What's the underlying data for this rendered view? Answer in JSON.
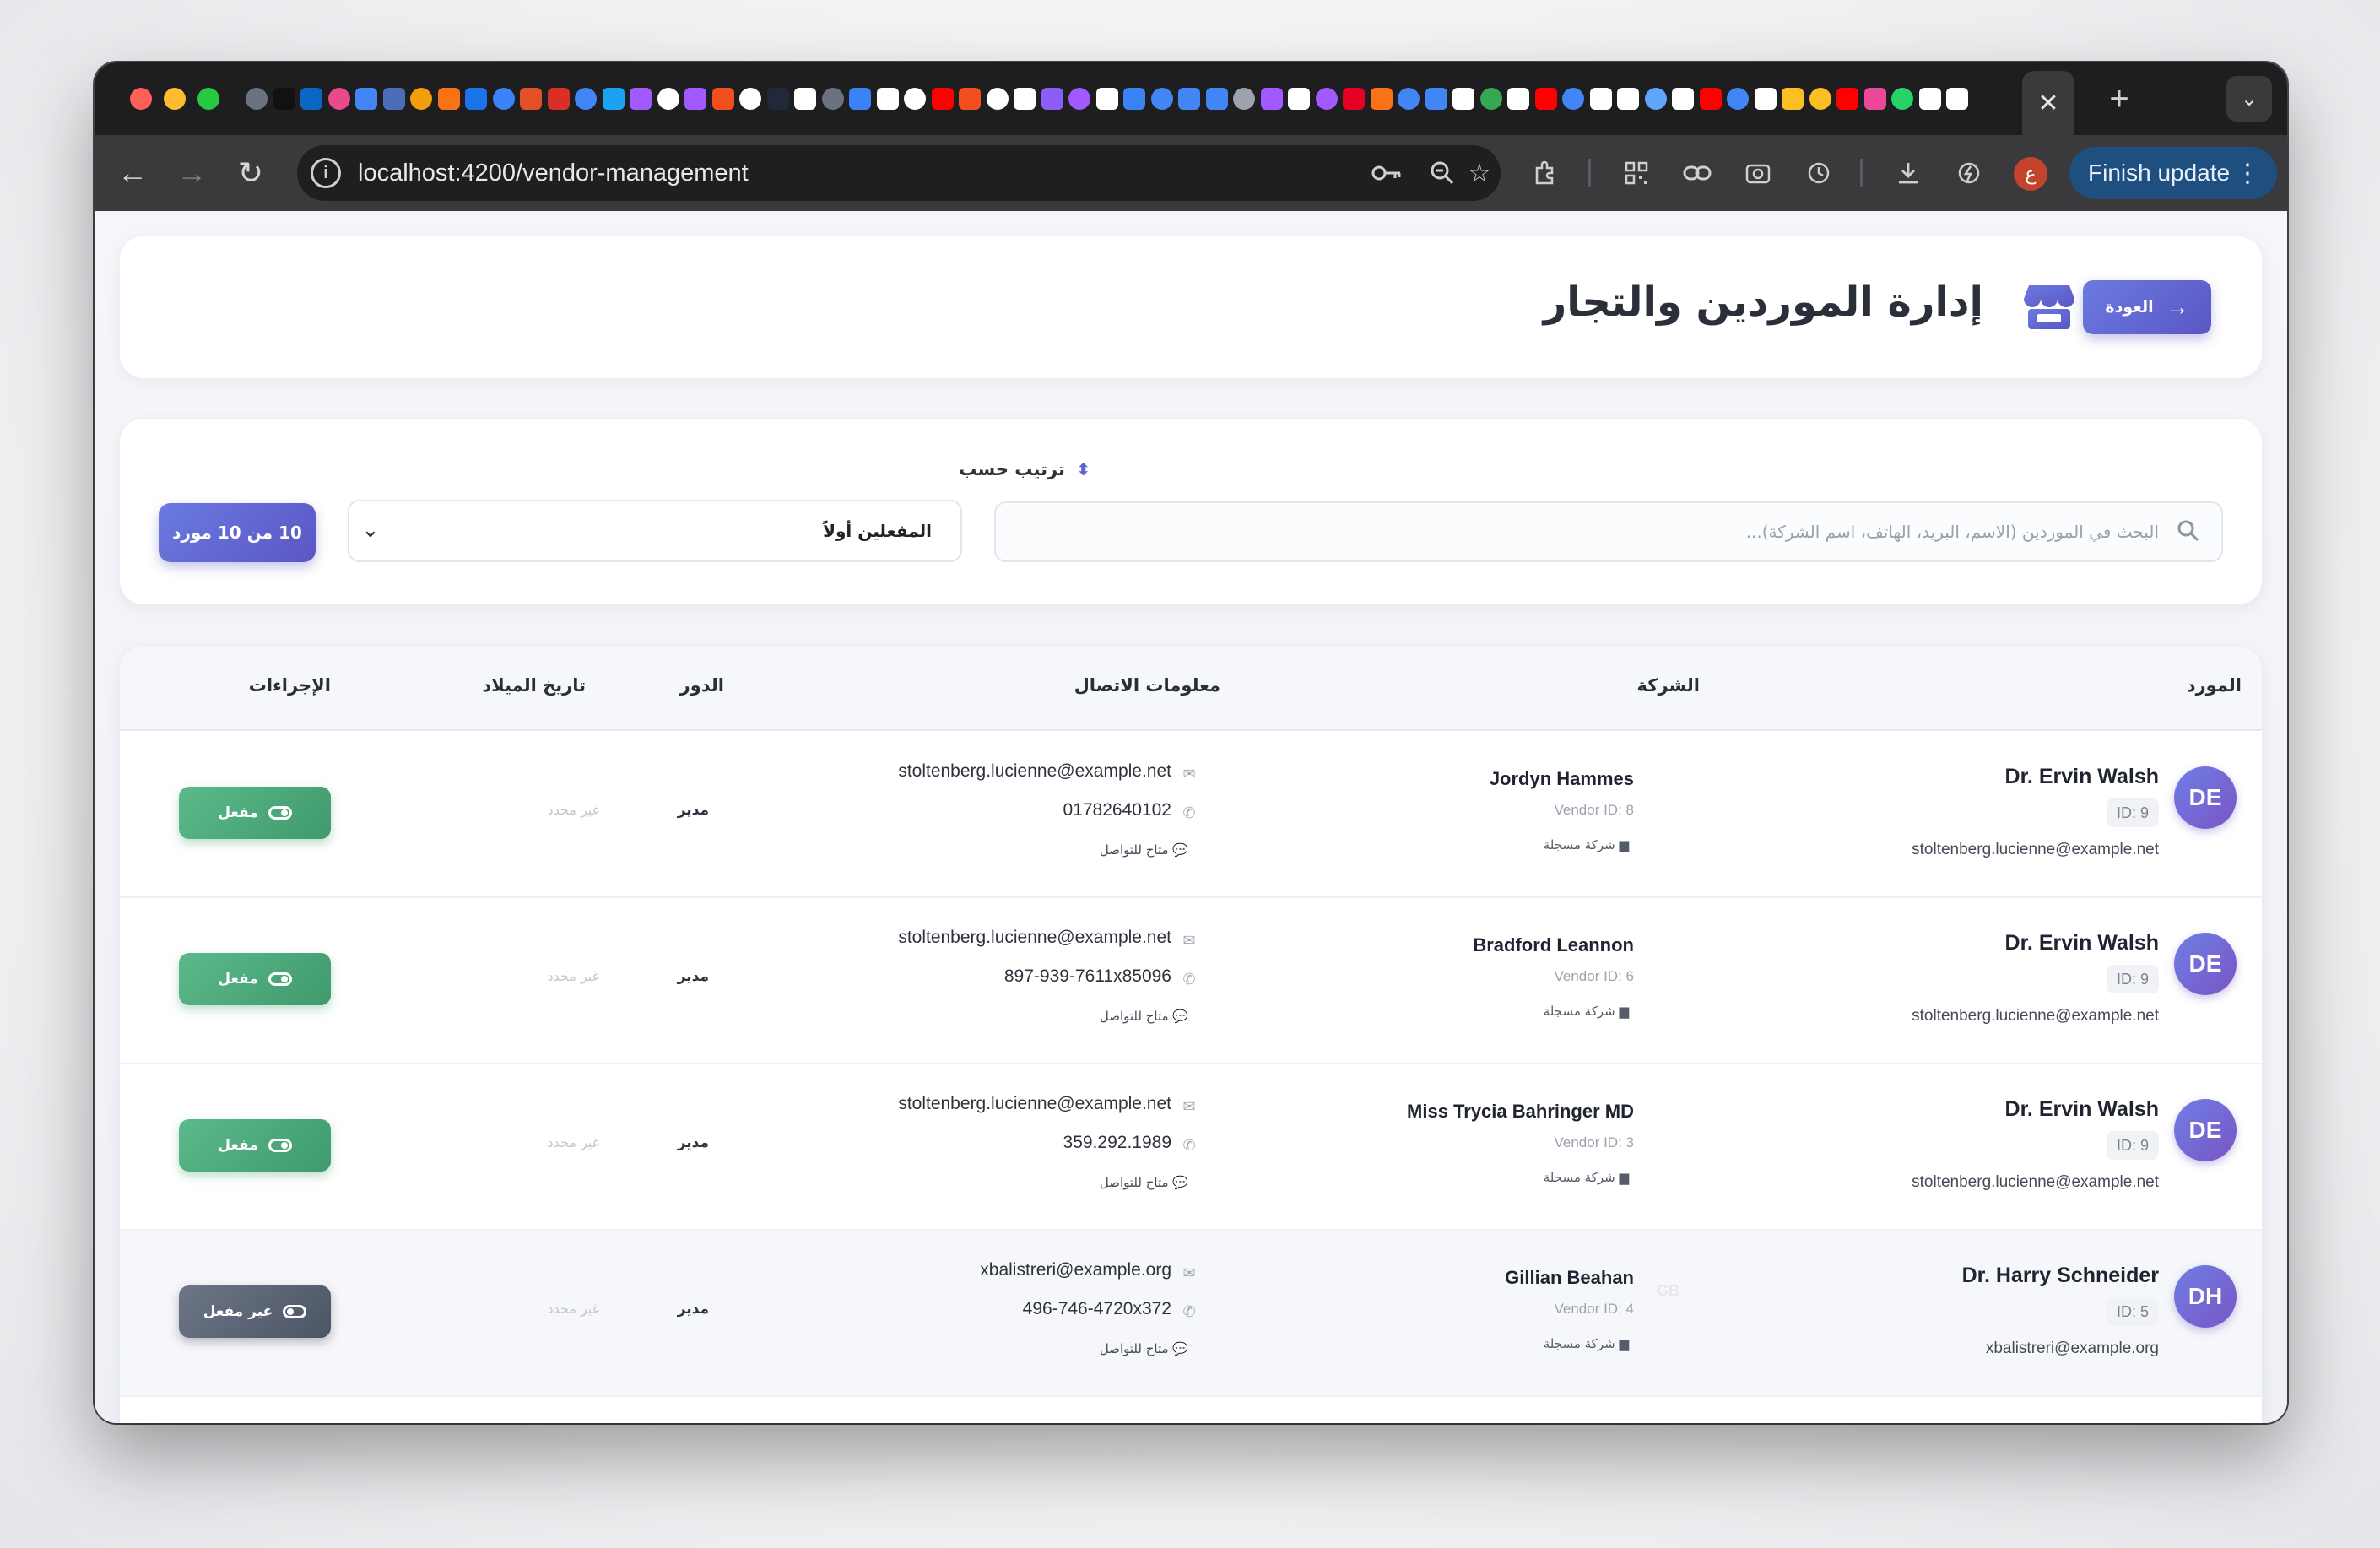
{
  "browser": {
    "url": "localhost:4200/vendor-management",
    "active_tab_close": "✕",
    "new_tab": "+",
    "finish_update_label": "Finish update",
    "profile_initial": "ع",
    "favicon_colors": [
      "#6b7280",
      "#111111",
      "#0a66c2",
      "#e84a8a",
      "#4285f4",
      "#4b6cb7",
      "#f59e0b",
      "#f97316",
      "#1a73e8",
      "#3b82f6",
      "#e34f26",
      "#d93025",
      "#4285f4",
      "#1da1f2",
      "#a259ff",
      "#ffffff",
      "#a259ff",
      "#f24e1e",
      "#ffffff",
      "#1f2937",
      "#ffffff",
      "#6b7280",
      "#3b82f6",
      "#ffffff",
      "#ffffff",
      "#ff0000",
      "#f24e1e",
      "#ffffff",
      "#ffffff",
      "#8b5cf6",
      "#a259ff",
      "#ffffff",
      "#3b82f6",
      "#4285f4",
      "#4285f4",
      "#4285f4",
      "#9ca3af",
      "#a259ff",
      "#ffffff",
      "#a259ff",
      "#e60023",
      "#f97316",
      "#4285f4",
      "#4285f4",
      "#ffffff",
      "#34a853",
      "#ffffff",
      "#ff0000",
      "#4285f4",
      "#ffffff",
      "#ffffff",
      "#60a5fa",
      "#ffffff",
      "#ff0000",
      "#4285f4",
      "#ffffff",
      "#fbbf24",
      "#fbbf24",
      "#ff0000",
      "#ec4899",
      "#25d366",
      "#ffffff",
      "#ffffff"
    ]
  },
  "header": {
    "back_label": "العودة",
    "title": "إدارة الموردين والتجار"
  },
  "filters": {
    "sort_label": "ترتيب حسب",
    "search_placeholder": "البحث في الموردين (الاسم، البريد، الهاتف، اسم الشركة)...",
    "sort_value": "المفعلين أولاً",
    "count_label": "10 من 10 مورد"
  },
  "table": {
    "headers": {
      "vendor": "المورد",
      "company": "الشركة",
      "contact": "معلومات الاتصال",
      "role": "الدور",
      "dob": "تاريخ الميلاد",
      "actions": "الإجراءات"
    },
    "rows": [
      {
        "initials": "DE",
        "name": "Dr. Ervin Walsh",
        "id": "ID: 9",
        "email": "stoltenberg.lucienne@example.net",
        "company": "Jordyn Hammes",
        "vendor_id": "Vendor ID: 8",
        "company_status": "شركة مسجلة",
        "contact_email": "stoltenberg.lucienne@example.net",
        "phone": "01782640102",
        "availability": "متاح للتواصل",
        "role": "مدير",
        "dob": "غير محدد",
        "status_label": "مفعل",
        "active": true
      },
      {
        "initials": "DE",
        "name": "Dr. Ervin Walsh",
        "id": "ID: 9",
        "email": "stoltenberg.lucienne@example.net",
        "company": "Bradford Leannon",
        "vendor_id": "Vendor ID: 6",
        "company_status": "شركة مسجلة",
        "contact_email": "stoltenberg.lucienne@example.net",
        "phone": "897-939-7611x85096",
        "availability": "متاح للتواصل",
        "role": "مدير",
        "dob": "غير محدد",
        "status_label": "مفعل",
        "active": true
      },
      {
        "initials": "DE",
        "name": "Dr. Ervin Walsh",
        "id": "ID: 9",
        "email": "stoltenberg.lucienne@example.net",
        "company": "Miss Trycia Bahringer MD",
        "vendor_id": "Vendor ID: 3",
        "company_status": "شركة مسجلة",
        "contact_email": "stoltenberg.lucienne@example.net",
        "phone": "359.292.1989",
        "availability": "متاح للتواصل",
        "role": "مدير",
        "dob": "غير محدد",
        "status_label": "مفعل",
        "active": true
      },
      {
        "initials": "DH",
        "name": "Dr. Harry Schneider",
        "id": "ID: 5",
        "email": "xbalistreri@example.org",
        "company": "Gillian Beahan",
        "company_initials": "GB",
        "vendor_id": "Vendor ID: 4",
        "company_status": "شركة مسجلة",
        "contact_email": "xbalistreri@example.org",
        "phone": "496-746-4720x372",
        "availability": "متاح للتواصل",
        "role": "مدير",
        "dob": "غير محدد",
        "status_label": "غير مفعل",
        "active": false
      }
    ]
  }
}
